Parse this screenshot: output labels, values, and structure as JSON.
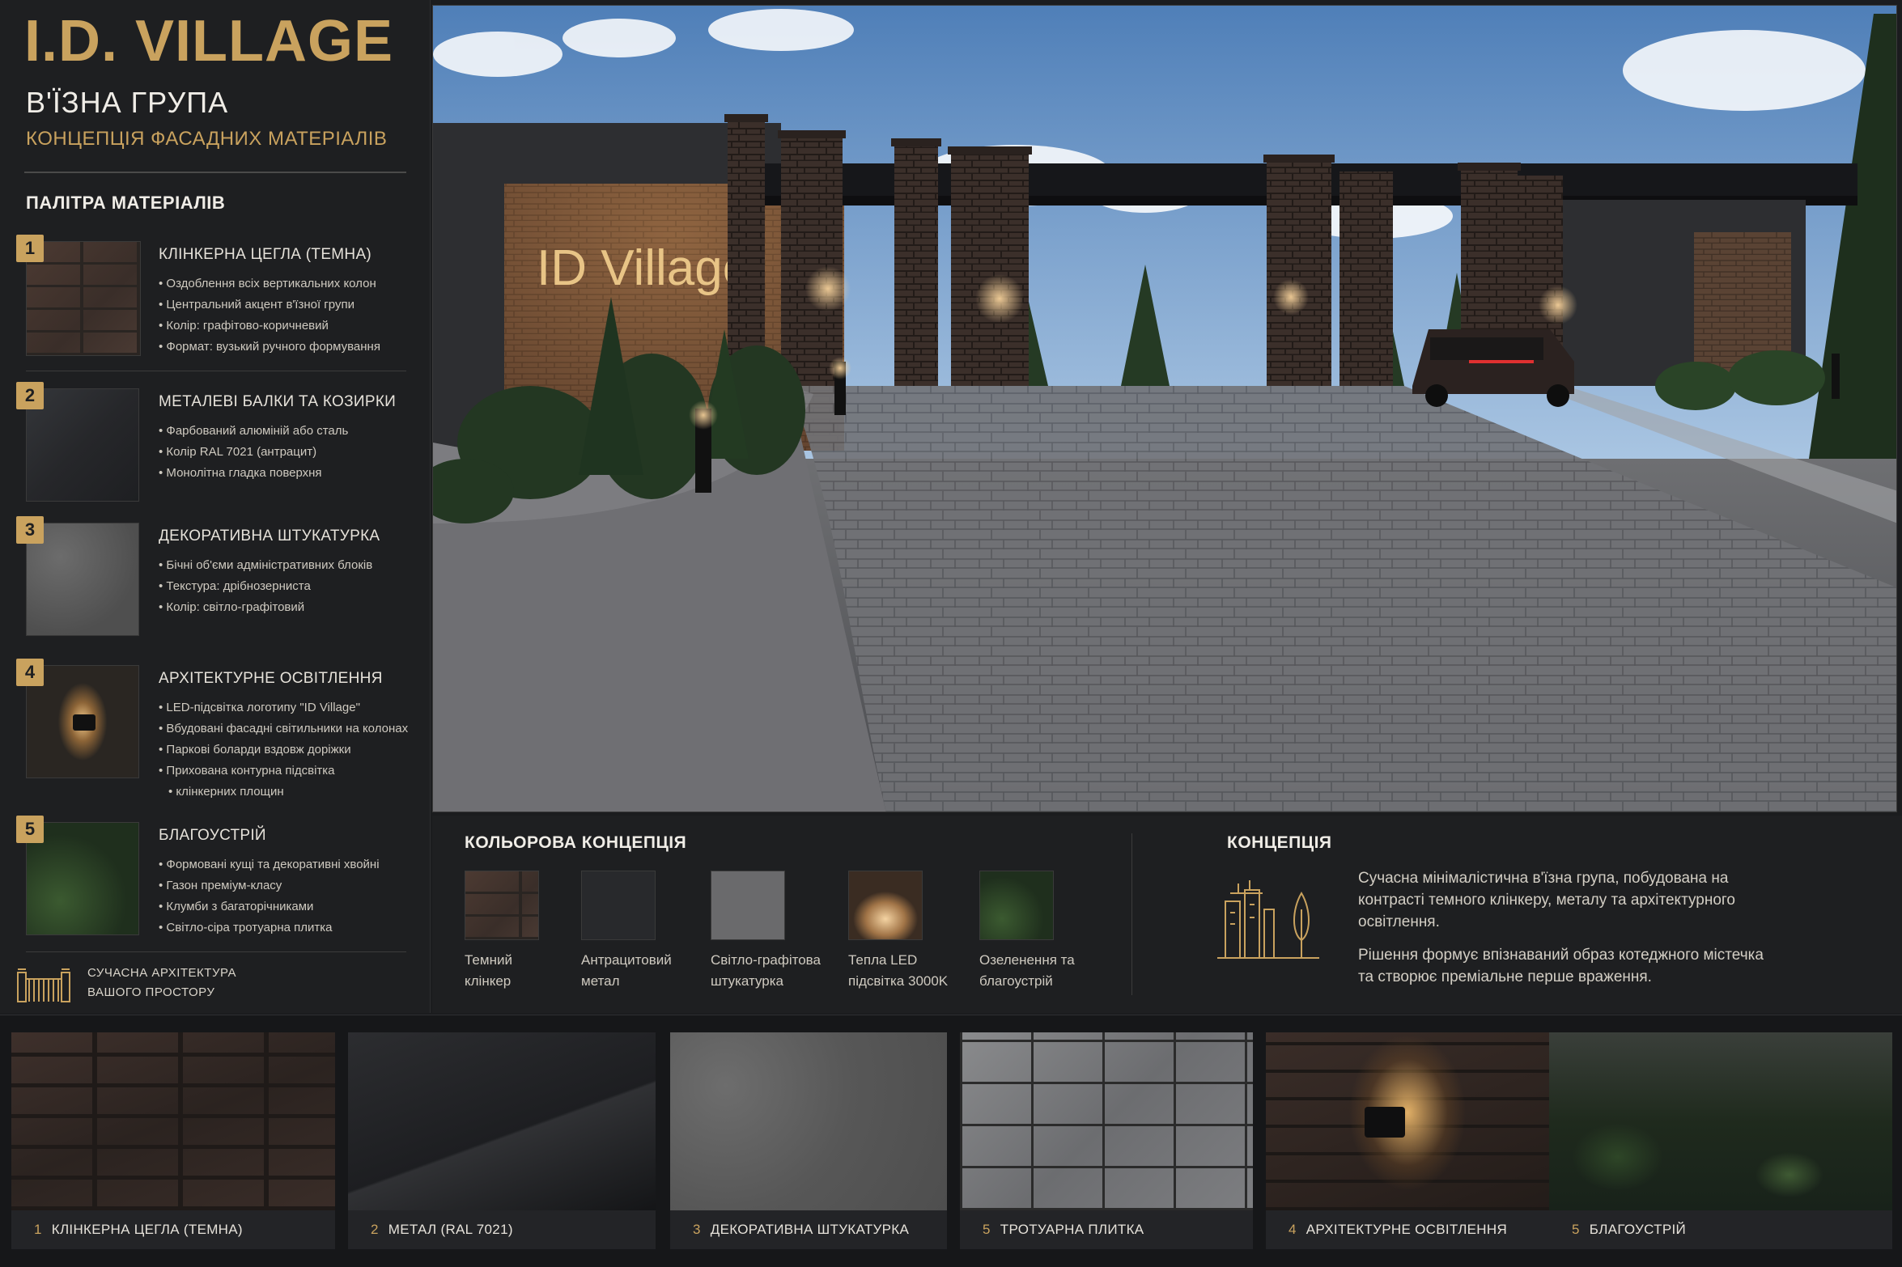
{
  "header": {
    "brand": "I.D. VILLAGE",
    "title": "В'ЇЗНА ГРУПА",
    "subtitle": "КОНЦЕПЦІЯ ФАСАДНИХ МАТЕРІАЛІВ"
  },
  "palette": {
    "title": "ПАЛІТРА МАТЕРІАЛІВ",
    "items": [
      {
        "num": "1",
        "title": "КЛІНКЕРНА ЦЕГЛА (ТЕМНА)",
        "bullets": [
          "Оздоблення всіх вертикальних колон",
          "Центральний акцент в'їзної групи",
          "Колір: графітово-коричневий",
          "Формат: вузький ручного формування"
        ]
      },
      {
        "num": "2",
        "title": "МЕТАЛЕВІ БАЛКИ ТА КОЗИРКИ",
        "bullets": [
          "Фарбований алюміній або сталь",
          "Колір RAL 7021 (антрацит)",
          "Монолітна гладка поверхня"
        ]
      },
      {
        "num": "3",
        "title": "ДЕКОРАТИВНА ШТУКАТУРКА",
        "bullets": [
          "Бічні об'єми адміністративних блоків",
          "Текстура: дрібнозерниста",
          "Колір: світло-графітовий"
        ]
      },
      {
        "num": "4",
        "title": "АРХІТЕКТУРНЕ ОСВІТЛЕННЯ",
        "bullets": [
          "LED-підсвітка логотипу \"ID Village\"",
          "Вбудовані фасадні світильники на колонах",
          "Паркові боларди вздовж доріжки",
          "Прихована контурна підсвітка",
          "клінкерних площин"
        ]
      },
      {
        "num": "5",
        "title": "БЛАГОУСТРІЙ",
        "bullets": [
          "Формовані кущі та декоративні хвойні",
          "Газон преміум-класу",
          "Клумби з багаторічниками",
          "Світло-сіра тротуарна плитка"
        ]
      }
    ]
  },
  "tagline": {
    "line1": "СУЧАСНА АРХІТЕКТУРА",
    "line2": "ВАШОГО ПРОСТОРУ"
  },
  "hero": {
    "sign": "ID Village"
  },
  "colors": {
    "title": "КОЛЬОРОВА КОНЦЕПЦІЯ",
    "items": [
      {
        "line1": "Темний",
        "line2": "клінкер"
      },
      {
        "line1": "Антрацитовий",
        "line2": "метал"
      },
      {
        "line1": "Світло-графітова",
        "line2": "штукатурка"
      },
      {
        "line1": "Тепла LED",
        "line2": "підсвітка 3000K"
      },
      {
        "line1": "Озеленення та",
        "line2": "благоустрій"
      }
    ]
  },
  "concept": {
    "title": "КОНЦЕПЦІЯ",
    "p1": "Сучасна мінімалістична в'їзна група, побудована на контрасті темного клінкеру, металу та архітектурного освітлення.",
    "p2": "Рішення формує впізнаваний образ котеджного містечка та створює преміальне перше враження."
  },
  "strip": [
    {
      "num": "1",
      "label": "КЛІНКЕРНА ЦЕГЛА (ТЕМНА)"
    },
    {
      "num": "2",
      "label": "МЕТАЛ (RAL 7021)"
    },
    {
      "num": "3",
      "label": "ДЕКОРАТИВНА ШТУКАТУРКА"
    },
    {
      "num": "5",
      "label": "ТРОТУАРНА ПЛИТКА"
    },
    {
      "num": "4",
      "label": "АРХІТЕКТУРНЕ ОСВІТЛЕННЯ"
    },
    {
      "num": "5",
      "label": "БЛАГОУСТРІЙ"
    }
  ],
  "accent_color": "#c9a25e",
  "background_color": "#1e1f21"
}
